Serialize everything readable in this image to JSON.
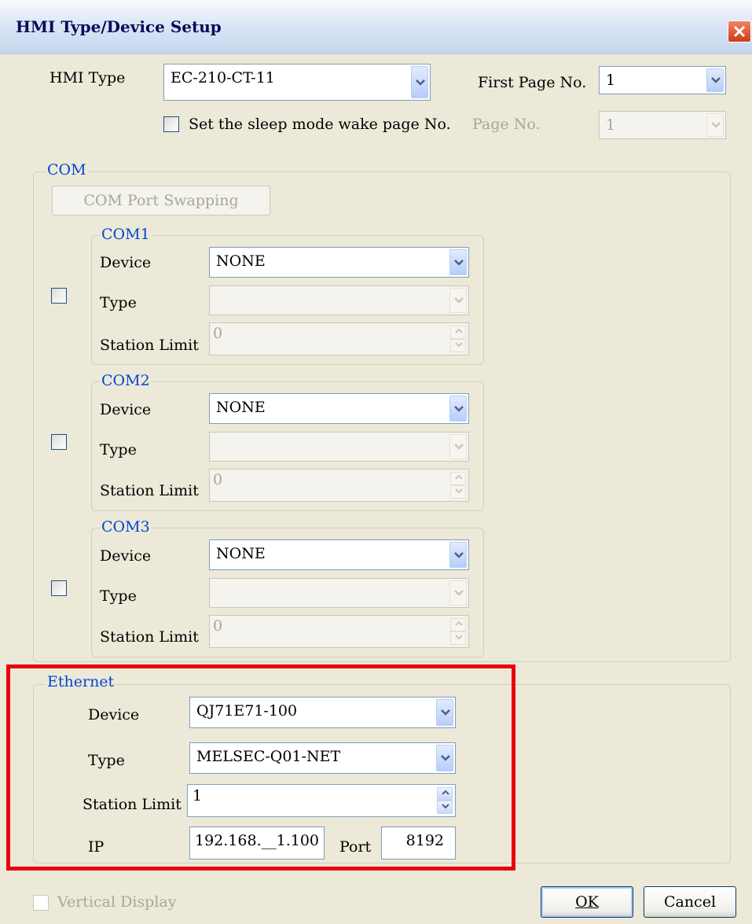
{
  "window": {
    "title": "HMI Type/Device Setup"
  },
  "hmi": {
    "type_label": "HMI Type",
    "type_value": "EC-210-CT-11",
    "first_page_label": "First Page No.",
    "first_page_value": "1",
    "sleep_checkbox_label": "Set the sleep mode wake page No.",
    "page_no_label": "Page No.",
    "page_no_value": "1"
  },
  "com": {
    "group_label": "COM",
    "swap_button": "COM Port Swapping",
    "ports": [
      {
        "label": "COM1",
        "device_label": "Device",
        "device_value": "NONE",
        "type_label": "Type",
        "type_value": "",
        "station_limit_label": "Station Limit",
        "station_limit_value": "0"
      },
      {
        "label": "COM2",
        "device_label": "Device",
        "device_value": "NONE",
        "type_label": "Type",
        "type_value": "",
        "station_limit_label": "Station Limit",
        "station_limit_value": "0"
      },
      {
        "label": "COM3",
        "device_label": "Device",
        "device_value": "NONE",
        "type_label": "Type",
        "type_value": "",
        "station_limit_label": "Station Limit",
        "station_limit_value": "0"
      }
    ]
  },
  "ethernet": {
    "group_label": "Ethernet",
    "device_label": "Device",
    "device_value": "QJ71E71-100",
    "type_label": "Type",
    "type_value": "MELSEC-Q01-NET",
    "station_limit_label": "Station Limit",
    "station_limit_value": "1",
    "ip_label": "IP",
    "ip_value": "192.168.__1.100",
    "port_label": "Port",
    "port_value": "8192"
  },
  "footer": {
    "vertical_display_label": "Vertical Display",
    "ok_label": "OK",
    "cancel_label": "Cancel"
  },
  "colors": {
    "highlight_box": "#e8000f",
    "group_label": "#0046d5",
    "dialog_bg": "#ece9d8"
  }
}
